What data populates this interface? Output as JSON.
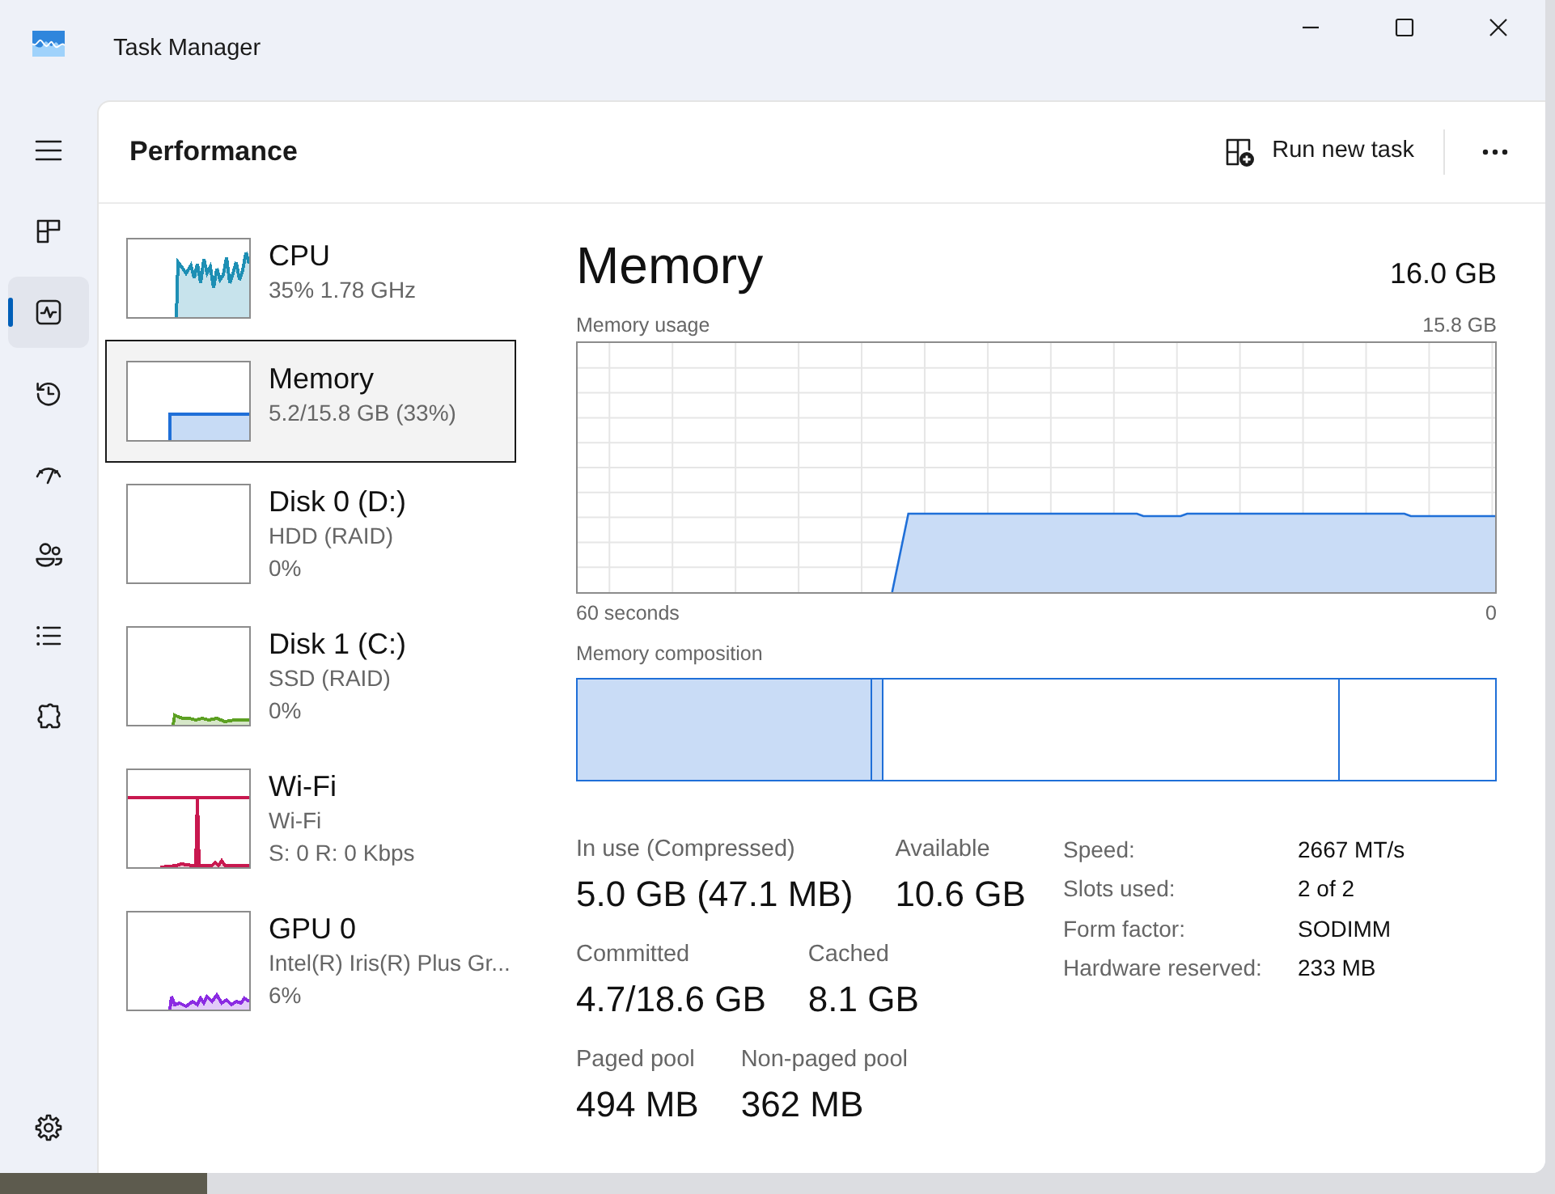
{
  "window": {
    "title": "Task Manager"
  },
  "nav_rail": {
    "items": [
      {
        "selected": false
      },
      {
        "selected": true
      },
      {
        "selected": false
      },
      {
        "selected": false
      },
      {
        "selected": false
      },
      {
        "selected": false
      },
      {
        "selected": false
      }
    ],
    "settings": {
      "selected": false
    }
  },
  "header": {
    "title": "Performance",
    "run_new_task": "Run new task"
  },
  "sidebar": {
    "items": [
      {
        "kind": "cpu",
        "name": "CPU",
        "details": [
          "35% 1.78 GHz"
        ],
        "color": "#1d8fb4",
        "selected": false
      },
      {
        "kind": "memory",
        "name": "Memory",
        "details": [
          "5.2/15.8 GB (33%)"
        ],
        "color": "#1f6fd8",
        "selected": true
      },
      {
        "kind": "disk",
        "name": "Disk 0 (D:)",
        "details": [
          "HDD (RAID)",
          "0%"
        ],
        "selected": false
      },
      {
        "kind": "disk",
        "name": "Disk 1 (C:)",
        "details": [
          "SSD (RAID)",
          "0%"
        ],
        "color": "#5ca022",
        "selected": false
      },
      {
        "kind": "network",
        "name": "Wi-Fi",
        "details": [
          "Wi-Fi",
          "S: 0 R: 0 Kbps"
        ],
        "color": "#c8184f",
        "selected": false
      },
      {
        "kind": "gpu",
        "name": "GPU 0",
        "details": [
          "Intel(R) Iris(R) Plus Gr...",
          "6%"
        ],
        "color": "#8b2be2",
        "selected": false
      }
    ]
  },
  "detail": {
    "title": "Memory",
    "total": "16.0 GB",
    "usage_label": "Memory usage",
    "usage_max": "15.8 GB",
    "axis_start": "60 seconds",
    "axis_end": "0",
    "composition_label": "Memory composition",
    "stat_rows": [
      {
        "stats": [
          {
            "label": "In use (Compressed)",
            "value": "5.0 GB (47.1 MB)"
          },
          {
            "label": "Available",
            "value": "10.6 GB"
          }
        ]
      },
      {
        "stats": [
          {
            "label": "Committed",
            "value": "4.7/18.6 GB"
          },
          {
            "label": "Cached",
            "value": "8.1 GB"
          }
        ]
      },
      {
        "stats": [
          {
            "label": "Paged pool",
            "value": "494 MB"
          },
          {
            "label": "Non-paged pool",
            "value": "362 MB"
          }
        ]
      }
    ],
    "specs": [
      {
        "label": "Speed:",
        "value": "2667 MT/s"
      },
      {
        "label": "Slots used:",
        "value": "2 of 2"
      },
      {
        "label": "Form factor:",
        "value": "SODIMM"
      },
      {
        "label": "Hardware reserved:",
        "value": "233 MB"
      }
    ]
  }
}
